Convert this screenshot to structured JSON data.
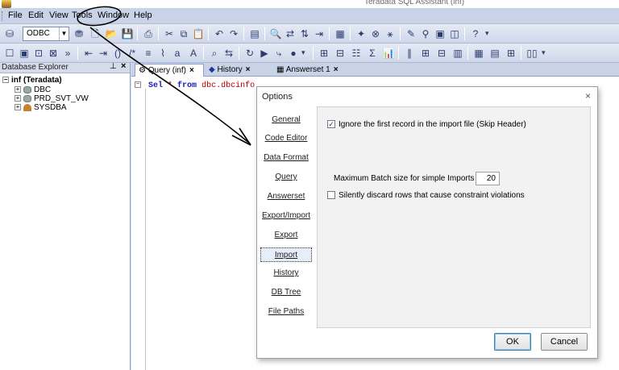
{
  "window": {
    "title": "Teradata SQL Assistant (inf)"
  },
  "menu": [
    "File",
    "Edit",
    "View",
    "Tools",
    "Window",
    "Help"
  ],
  "toolbar": {
    "connection": "ODBC"
  },
  "explorer": {
    "title": "Database Explorer",
    "root": "inf (Teradata)",
    "items": [
      "DBC",
      "PRD_SVT_VW",
      "SYSDBA"
    ]
  },
  "tabs": [
    {
      "label": "Query (inf)"
    },
    {
      "label": "History"
    },
    {
      "label": "Answerset 1"
    }
  ],
  "editor": {
    "kw": "Sel",
    "star": " * ",
    "kw2": "from",
    "rest": " dbc.dbcinfo"
  },
  "dialog": {
    "title": "Options",
    "nav": [
      "General",
      "Code Editor",
      "Data Format",
      "Query",
      "Answerset",
      "Export/Import",
      "Export",
      "Import",
      "History",
      "DB Tree",
      "File Paths"
    ],
    "selected": "Import",
    "skip_header_label": "Ignore the first record in the import file (Skip Header)",
    "skip_header_checked": true,
    "batch_label": "Maximum Batch size for simple Imports",
    "batch_value": "20",
    "discard_label": "Silently discard rows that cause constraint violations",
    "discard_checked": false,
    "ok": "OK",
    "cancel": "Cancel"
  },
  "colors": {
    "annotation": "#000000",
    "accent": "#1b1bb0"
  }
}
